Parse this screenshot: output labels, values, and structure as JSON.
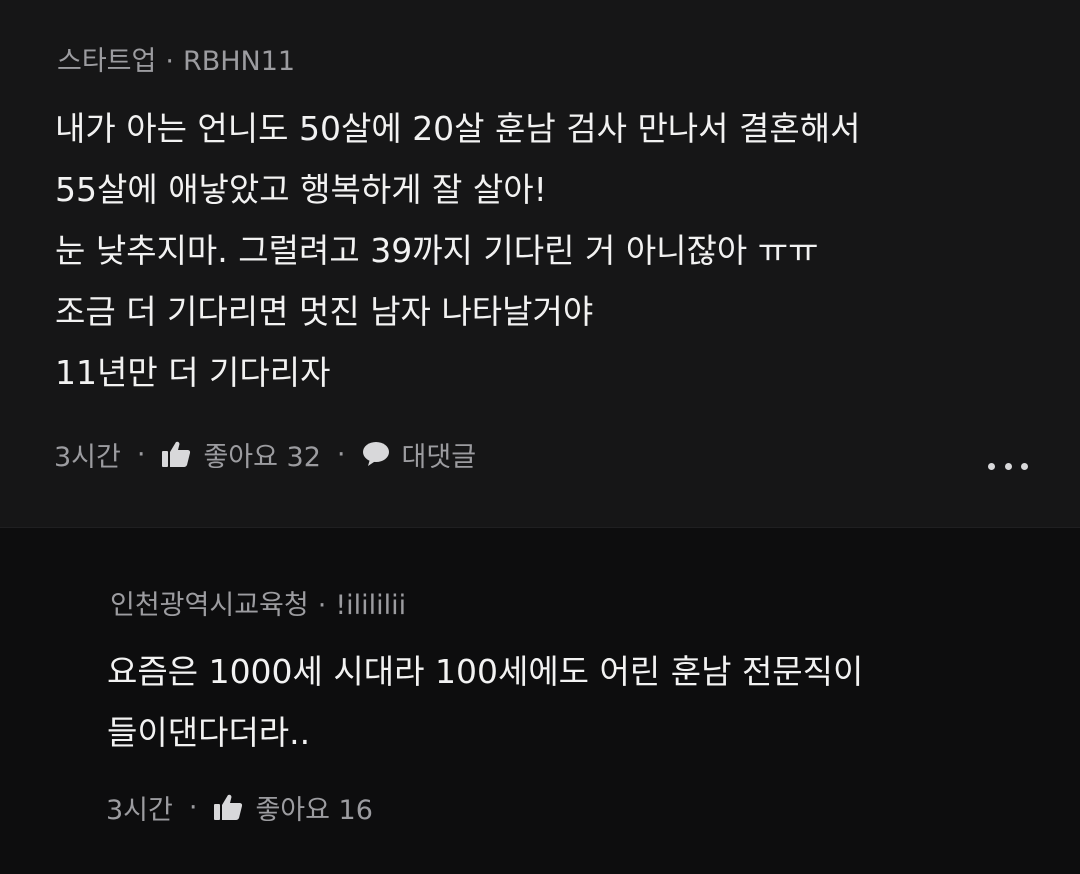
{
  "main_comment": {
    "channel": "스타트업",
    "author": "RBHN11",
    "separator": "·",
    "text": "내가 아는 언니도 50살에 20살 훈남 검사 만나서 결혼해서\n55살에 애낳았고 행복하게 잘 살아!\n눈 낮추지마. 그럴려고 39까지 기다린 거 아니잖아 ㅠㅠ\n조금 더 기다리면 멋진 남자 나타날거야\n11년만 더 기다리자",
    "time": "3시간",
    "like_label": "좋아요 32",
    "reply_label": "대댓글",
    "more_icon": "more-horizontal-icon"
  },
  "reply_comment": {
    "channel": "인천광역시교육청",
    "author": "!ilililiⅰ",
    "separator": "·",
    "text": "요즘은 1000세 시대라 100세에도 어린 훈남 전문직이\n들이댄다더라..",
    "time": "3시간",
    "like_label": "좋아요 16"
  },
  "colors": {
    "background_main": "#161617",
    "background_reply": "#0d0d0e",
    "text_primary": "#f2f2f2",
    "text_secondary": "#9c9ca0"
  }
}
